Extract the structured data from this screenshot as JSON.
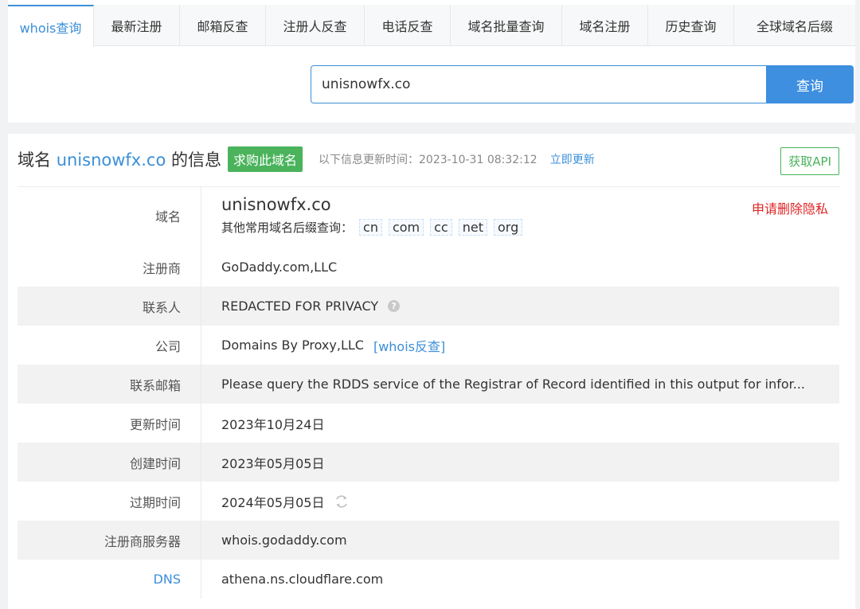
{
  "nav": {
    "tabs": [
      {
        "label": "whois查询",
        "active": true
      },
      {
        "label": "最新注册"
      },
      {
        "label": "邮箱反查"
      },
      {
        "label": "注册人反查"
      },
      {
        "label": "电话反查"
      },
      {
        "label": "域名批量查询"
      },
      {
        "label": "域名注册"
      },
      {
        "label": "历史查询"
      },
      {
        "label": "全球域名后缀"
      }
    ]
  },
  "search": {
    "value": "unisnowfx.co",
    "button": "查询"
  },
  "header": {
    "prefix": "域名",
    "domain": "unisnowfx.co",
    "suffix": "的信息",
    "buy_badge": "求购此域名",
    "update_label": "以下信息更新时间：2023-10-31 08:32:12",
    "update_now": "立即更新",
    "api_button": "获取API"
  },
  "whois": {
    "domain_label": "域名",
    "domain_value": "unisnowfx.co",
    "suffix_label": "其他常用域名后缀查询：",
    "suffixes": [
      "cn",
      "com",
      "cc",
      "net",
      "org"
    ],
    "delete_privacy": "申请删除隐私",
    "registrar_label": "注册商",
    "registrar_value": "GoDaddy.com,LLC",
    "contact_label": "联系人",
    "contact_value": "REDACTED FOR PRIVACY",
    "company_label": "公司",
    "company_value": "Domains By Proxy,LLC",
    "company_link": "[whois反查]",
    "email_label": "联系邮箱",
    "email_value": "Please query the RDDS service of the Registrar of Record identified in this output for infor...",
    "updated_label": "更新时间",
    "updated_value": "2023年10月24日",
    "created_label": "创建时间",
    "created_value": "2023年05月05日",
    "expires_label": "过期时间",
    "expires_value": "2024年05月05日",
    "whois_server_label": "注册商服务器",
    "whois_server_value": "whois.godaddy.com",
    "dns_label": "DNS",
    "dns_value": "athena.ns.cloudflare.com"
  },
  "icons": {
    "help": "help-circle-icon",
    "refresh": "refresh-icon"
  },
  "colors": {
    "accent": "#3b8fd8",
    "green": "#4ab35b",
    "red": "#e02424"
  }
}
